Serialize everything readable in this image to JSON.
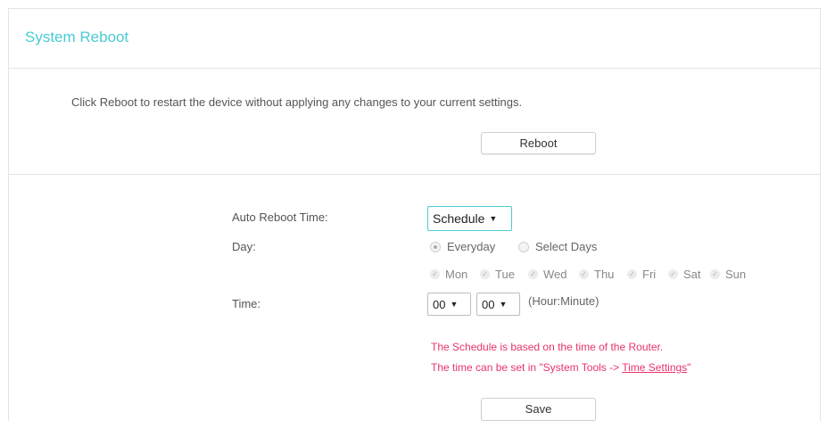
{
  "header": {
    "title": "System Reboot"
  },
  "reboot": {
    "description": "Click Reboot to restart the device without applying any changes to your current settings.",
    "button_label": "Reboot"
  },
  "schedule": {
    "auto_reboot_label": "Auto Reboot Time:",
    "auto_reboot_value": "Schedule",
    "day_label": "Day:",
    "day_options": [
      {
        "label": "Everyday",
        "selected": true
      },
      {
        "label": "Select Days",
        "selected": false
      }
    ],
    "days": [
      {
        "label": "Mon",
        "checked": true
      },
      {
        "label": "Tue",
        "checked": true
      },
      {
        "label": "Wed",
        "checked": true
      },
      {
        "label": "Thu",
        "checked": true
      },
      {
        "label": "Fri",
        "checked": true
      },
      {
        "label": "Sat",
        "checked": true
      },
      {
        "label": "Sun",
        "checked": true
      }
    ],
    "time_label": "Time:",
    "hour_value": "00",
    "minute_value": "00",
    "time_format": "(Hour:Minute)",
    "note_line1": "The Schedule is based on the time of the Router.",
    "note_line2_prefix": "The time can be set in \"System Tools -> ",
    "note_link": "Time Settings",
    "note_line2_suffix": "\"",
    "save_label": "Save"
  },
  "icons": {
    "dropdown_arrow": "▼",
    "check": "✓"
  },
  "colors": {
    "title": "#4acbd6",
    "focus_border": "#4acbd6",
    "note": "#e8346b"
  }
}
